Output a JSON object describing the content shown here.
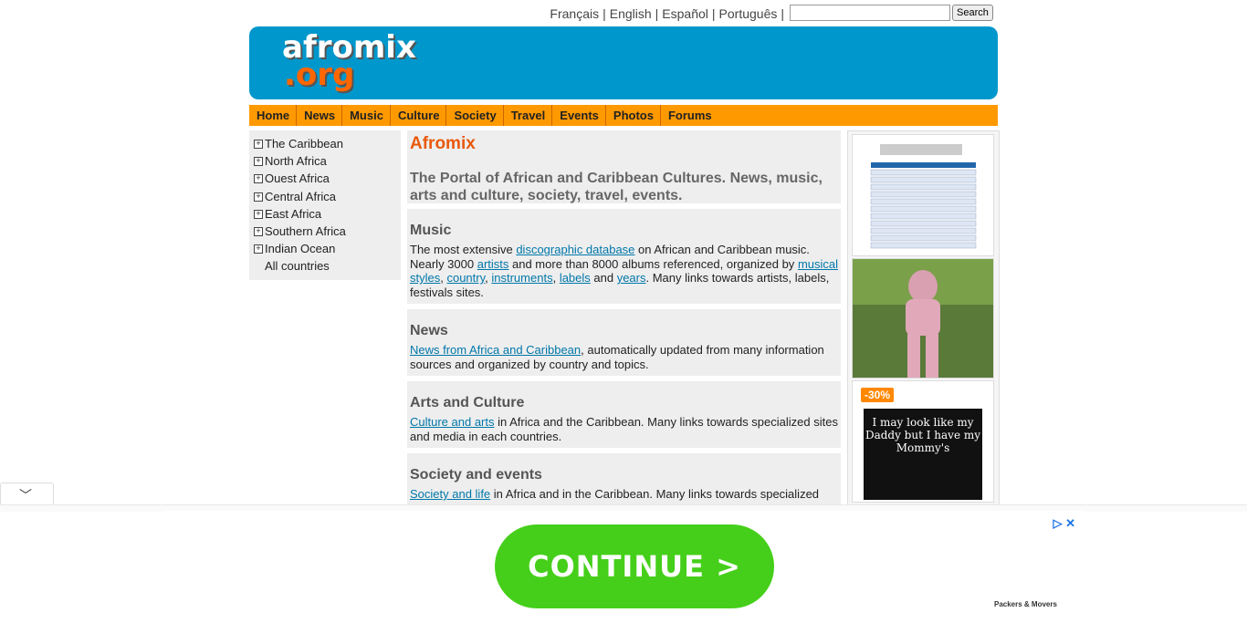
{
  "languages": [
    "Français",
    "English",
    "Español",
    "Português"
  ],
  "search": {
    "placeholder": "",
    "button": "Search"
  },
  "logo": {
    "line1": "afromix",
    "line2": ".org"
  },
  "nav": [
    "Home",
    "News",
    "Music",
    "Culture",
    "Society",
    "Travel",
    "Events",
    "Photos",
    "Forums"
  ],
  "sidebar": {
    "regions": [
      "The Caribbean",
      "North Africa",
      "Ouest Africa",
      "Central Africa",
      "East Africa",
      "Southern Africa",
      "Indian Ocean"
    ],
    "all": "All countries"
  },
  "intro": {
    "title": "Afromix",
    "tagline": "The Portal of African and Caribbean Cultures. News, music, arts and culture, society, travel, events."
  },
  "music": {
    "heading": "Music",
    "t1": "The most extensive ",
    "link1": "discographic database",
    "t2": " on African and Caribbean music. Nearly 3000 ",
    "link2": "artists",
    "t3": " and more than 8000 albums referenced, organized by ",
    "link3": "musical styles",
    "t4": ", ",
    "link4": "country",
    "t5": ", ",
    "link5": "instruments",
    "t6": ", ",
    "link6": "labels",
    "t7": " and ",
    "link7": "years",
    "t8": ". Many links towards artists, labels, festivals sites."
  },
  "news": {
    "heading": "News",
    "link": "News from Africa and Caribbean",
    "text": ", automatically updated from many information sources and organized by country and topics."
  },
  "arts": {
    "heading": "Arts and Culture",
    "link": "Culture and arts",
    "text": " in Africa and the Caribbean. Many links towards specialized sites and media in each countries."
  },
  "society": {
    "heading": "Society and events",
    "link": "Society and life",
    "text": " in Africa and in the Caribbean. Many links towards specialized"
  },
  "right_ad": {
    "discount": "-30%",
    "shirt_text": "I may look like my Daddy but I have my Mommy's"
  },
  "bottom_ad": {
    "button": "CONTINUE >",
    "brand": "Packers & Movers"
  }
}
